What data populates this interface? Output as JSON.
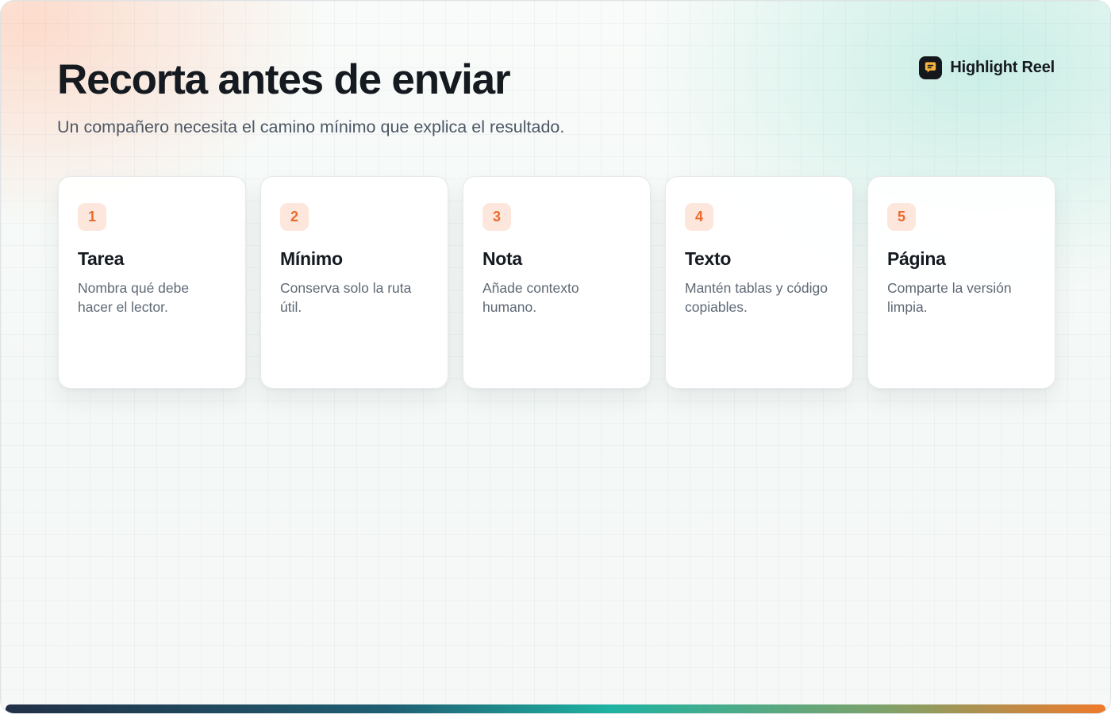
{
  "header": {
    "title": "Recorta antes de enviar",
    "subtitle": "Un compañero necesita el camino mínimo que explica el resultado."
  },
  "brand": {
    "name": "Highlight Reel",
    "icon": "chat-bubble-icon"
  },
  "steps": [
    {
      "number": "1",
      "title": "Tarea",
      "description": "Nombra qué debe hacer el lector."
    },
    {
      "number": "2",
      "title": "Mínimo",
      "description": "Conserva solo la ruta útil."
    },
    {
      "number": "3",
      "title": "Nota",
      "description": "Añade contexto humano."
    },
    {
      "number": "4",
      "title": "Texto",
      "description": "Mantén tablas y código copiables."
    },
    {
      "number": "5",
      "title": "Página",
      "description": "Comparte la versión limpia."
    }
  ],
  "colors": {
    "accent": "#ec6a2c",
    "badge_bg": "#fde7dd",
    "ink": "#151a20",
    "bar_start": "#213047",
    "bar_mid": "#1fb2a2",
    "bar_end": "#ee7a2b"
  }
}
